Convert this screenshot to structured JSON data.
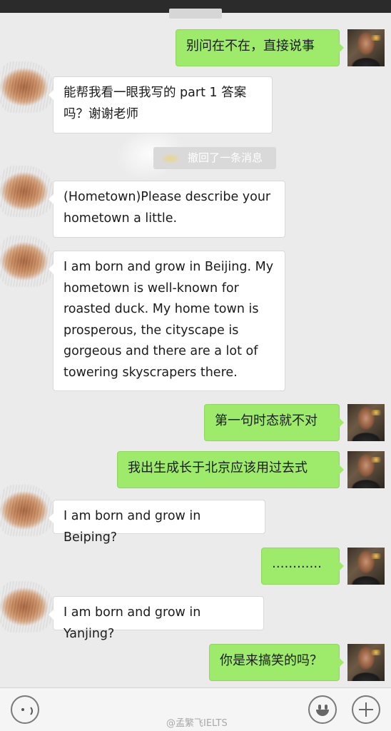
{
  "watermark": "@孟繁飞IELTS",
  "recalled_notice": "撤回了一条消息",
  "messages": [
    {
      "side": "out",
      "text": "别问在不在，直接说事"
    },
    {
      "side": "in",
      "text": "能帮我看一眼我写的 part 1 答案吗？谢谢老师"
    },
    {
      "side": "in",
      "text": "(Hometown)Please describe your hometown a little."
    },
    {
      "side": "in",
      "text": "I am born and grow in Beijing. My hometown is well-known for roasted duck. My home town is prosperous, the cityscape is gorgeous and there are a lot of towering skyscrapers there."
    },
    {
      "side": "out",
      "text": "第一句时态就不对"
    },
    {
      "side": "out",
      "text": "我出生成长于北京应该用过去式"
    },
    {
      "side": "in",
      "text": "I am born and grow in Beiping?"
    },
    {
      "side": "out",
      "text": "…………"
    },
    {
      "side": "in",
      "text": "I am born and grow in Yanjing?"
    },
    {
      "side": "out",
      "text": "你是来搞笑的吗？"
    }
  ],
  "input_bar": {
    "left_icon": "voice-icon",
    "right_icons": [
      "emoji-icon",
      "plus-icon"
    ]
  },
  "colors": {
    "background": "#ebebeb",
    "outgoing_bubble": "#9eea6a",
    "incoming_bubble": "#ffffff"
  }
}
